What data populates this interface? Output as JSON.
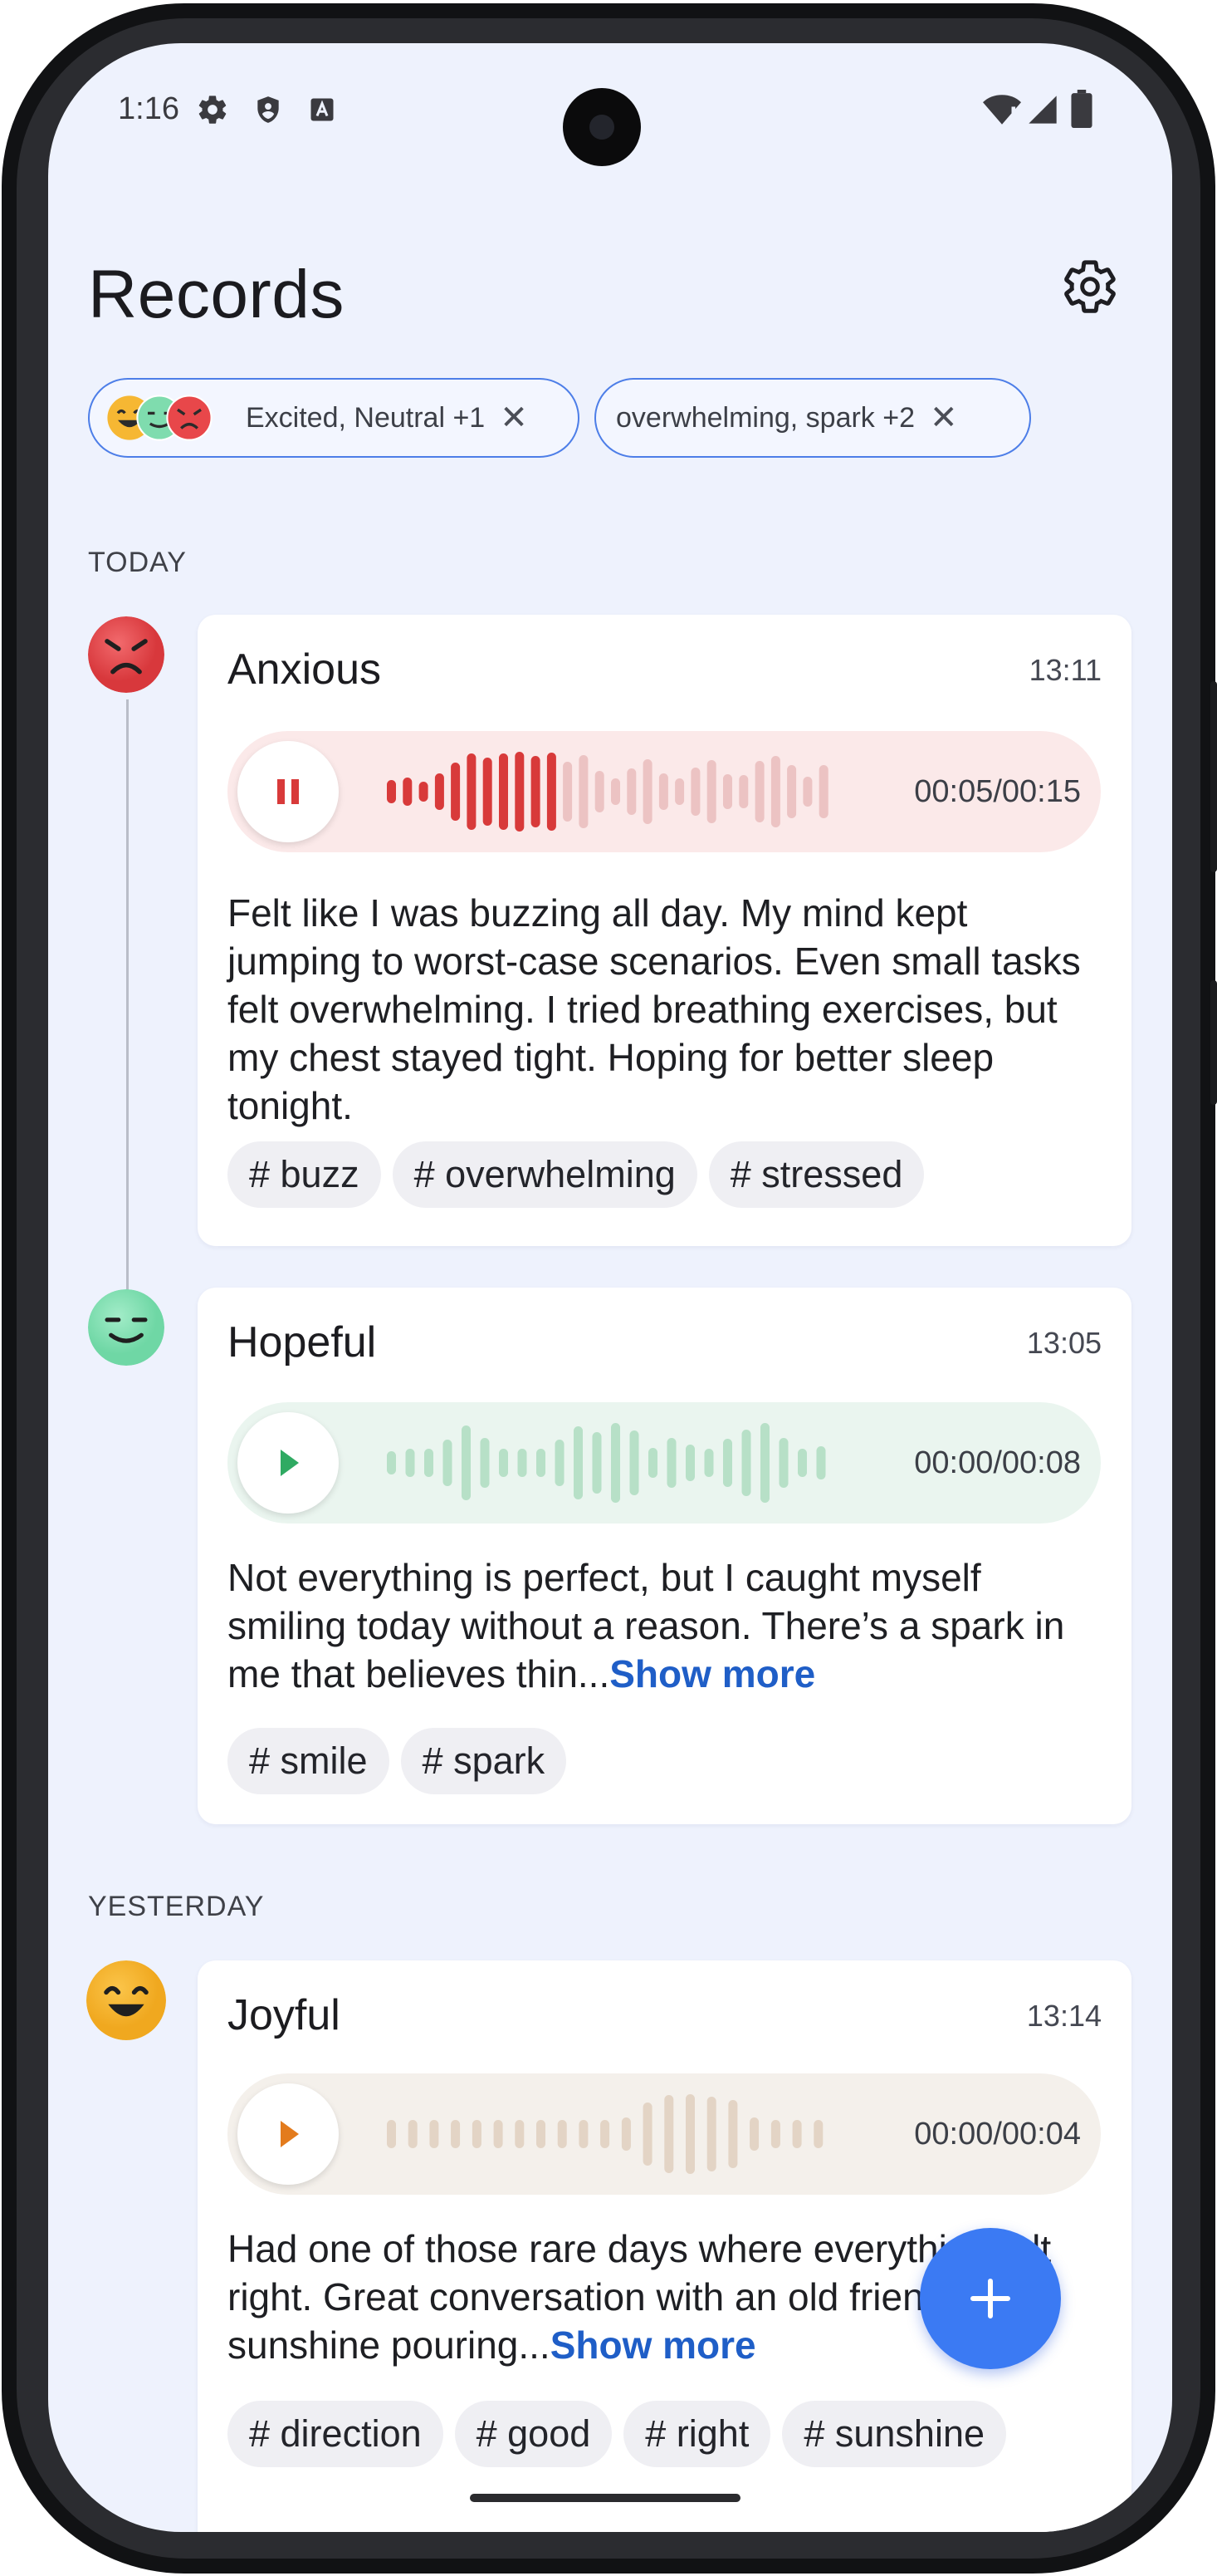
{
  "status_bar": {
    "time": "1:16",
    "icons": [
      "gear-icon",
      "shield-icon",
      "a-box-icon",
      "wifi-alert-icon",
      "signal-icon",
      "battery-icon"
    ]
  },
  "header": {
    "title": "Records",
    "settings_icon": "gear-icon"
  },
  "filters": [
    {
      "label": "Excited, Neutral +1",
      "icons": [
        "excited-face-icon",
        "neutral-face-icon",
        "angry-face-icon"
      ],
      "remove_icon": "close-icon"
    },
    {
      "label": "overwhelming, spark +2",
      "remove_icon": "close-icon"
    }
  ],
  "sections": [
    {
      "label": "TODAY",
      "records": [
        {
          "mood": "Anxious",
          "time": "13:11",
          "mood_icon": "angry-face-icon",
          "state": "playing",
          "duration": "00:05/00:15",
          "progress": 0.33,
          "text": "Felt like I was buzzing all day. My mind kept jumping to worst-case scenarios. Even small tasks felt overwhelming. I tried breathing exercises, but my chest stayed tight. Hoping for better sleep tonight.",
          "show_more": "",
          "tags": [
            "# buzz",
            "# overwhelming",
            "# stressed"
          ],
          "accent": "#d83a3a",
          "track_bg": "#fbe9e9",
          "bar_idle": "#ecc3c3"
        },
        {
          "mood": "Hopeful",
          "time": "13:05",
          "mood_icon": "smiling-face-icon",
          "state": "paused",
          "duration": "00:00/00:08",
          "progress": 0,
          "text": "Not everything is perfect, but I caught myself smiling today without a reason. There’s a spark in me that believes thin...",
          "show_more": "Show more",
          "tags": [
            "# smile",
            "# spark"
          ],
          "accent": "#2faa62",
          "track_bg": "#eaf5ef",
          "bar_idle": "#b7e0c7"
        }
      ]
    },
    {
      "label": "YESTERDAY",
      "records": [
        {
          "mood": "Joyful",
          "time": "13:14",
          "mood_icon": "joyful-face-icon",
          "state": "paused",
          "duration": "00:00/00:04",
          "progress": 0,
          "text": "Had one of those rare days where everything felt right. Great conversation with an old friend, sunshine pouring...",
          "show_more": "Show more",
          "tags": [
            "# direction",
            "# good",
            "# right",
            "# sunshine"
          ],
          "accent": "#e37b1d",
          "track_bg": "#f4f0eb",
          "bar_idle": "#e3d4c5"
        }
      ]
    }
  ],
  "fab": {
    "icon": "plus-icon"
  },
  "colors": {
    "primary": "#3b7af3",
    "background": "#eef2fd",
    "link": "#1f5ec7"
  }
}
